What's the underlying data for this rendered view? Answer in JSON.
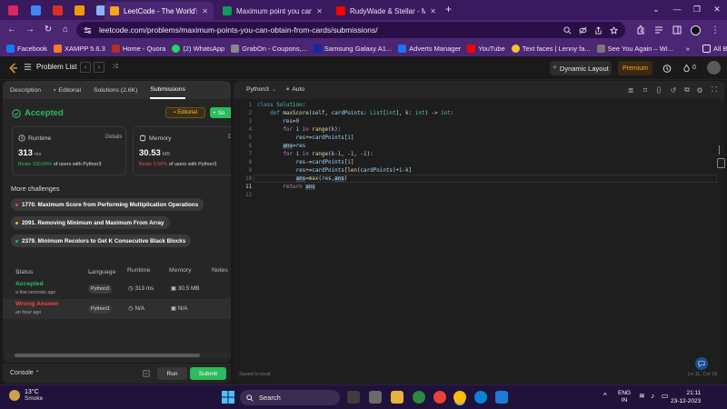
{
  "browser": {
    "tabs": [
      {
        "title": "LeetCode - The World's Leading",
        "active": true
      },
      {
        "title": "Maximum point you can obtain f",
        "active": false
      },
      {
        "title": "RudyWade & Stellar - Moving C",
        "active": false
      }
    ],
    "new_tab": "+",
    "url": "leetcode.com/problems/maximum-points-you-can-obtain-from-cards/submissions/",
    "bookmarks": [
      {
        "label": "Facebook",
        "color": "#1877f2"
      },
      {
        "label": "XAMPP 5.6.3",
        "color": "#fb7a24"
      },
      {
        "label": "Home - Quora",
        "color": "#b92b27"
      },
      {
        "label": "(2) WhatsApp",
        "color": "#25d366"
      },
      {
        "label": "GrabOn - Coupons,...",
        "color": "#888888"
      },
      {
        "label": "Samsung Galaxy A1...",
        "color": "#1428a0"
      },
      {
        "label": "Adverts Manager",
        "color": "#1877f2"
      },
      {
        "label": "YouTube",
        "color": "#ff0000"
      },
      {
        "label": "Text faces | Lenny fa...",
        "color": "#f4c430"
      },
      {
        "label": "See You Again – Wi...",
        "color": "#777777"
      }
    ],
    "more_bookmarks": "»",
    "all_bookmarks": "All Bookmarks"
  },
  "header": {
    "problem_list": "Problem List",
    "dynamic_layout": "Dynamic Layout",
    "premium": "Premium",
    "timer_count": "0"
  },
  "left": {
    "tabs": [
      "Description",
      "Editorial",
      "Solutions (2.6K)",
      "Submissions"
    ],
    "status": "Accepted",
    "editorial_btn": "Editorial",
    "solution_btn": "+ So",
    "runtime": {
      "label": "Runtime",
      "details": "Details",
      "value": "313",
      "unit": "ms",
      "beats_pct": "Beats 100.00%",
      "beats_rest": " of users with Python3"
    },
    "memory": {
      "label": "Memory",
      "details": "De",
      "value": "30.53",
      "unit": "MB",
      "beats_pct": "Beats 5.56%",
      "beats_rest": " of users with Python3"
    },
    "more_challenges": "More challenges",
    "challenges": [
      {
        "text": "1770. Maximum Score from Performing Multiplication Operations",
        "color": "#ff375f"
      },
      {
        "text": "2091. Removing Minimum and Maximum From Array",
        "color": "#ffb800"
      },
      {
        "text": "2379. Minimum Recolors to Get K Consecutive Black Blocks",
        "color": "#00b8a3"
      }
    ],
    "table_headers": {
      "status": "Status",
      "language": "Language",
      "runtime": "Runtime",
      "memory": "Memory",
      "notes": "Notes"
    },
    "submissions": [
      {
        "status": "Accepted",
        "time": "a few seconds ago",
        "language": "Python3",
        "runtime": "313 ms",
        "memory": "30.5 MB",
        "color": "#2cbb5d"
      },
      {
        "status": "Wrong Answer",
        "time": "an hour ago",
        "language": "Python3",
        "runtime": "N/A",
        "memory": "N/A",
        "color": "#ef4743"
      }
    ]
  },
  "console": {
    "label": "Console",
    "run": "Run",
    "submit": "Submit"
  },
  "editor": {
    "language": "Python3",
    "mode": "Auto",
    "line_numbers": [
      "1",
      "2",
      "3",
      "4",
      "5",
      "6",
      "7",
      "8",
      "9",
      "10",
      "11",
      "12"
    ],
    "saved": "Saved to local",
    "position": "Ln 11, Col 19"
  },
  "taskbar": {
    "temp": "13°C",
    "weather": "Smoke",
    "search": "Search",
    "lang": "ENG",
    "region": "IN",
    "time": "21:11",
    "date": "23-12-2023"
  }
}
